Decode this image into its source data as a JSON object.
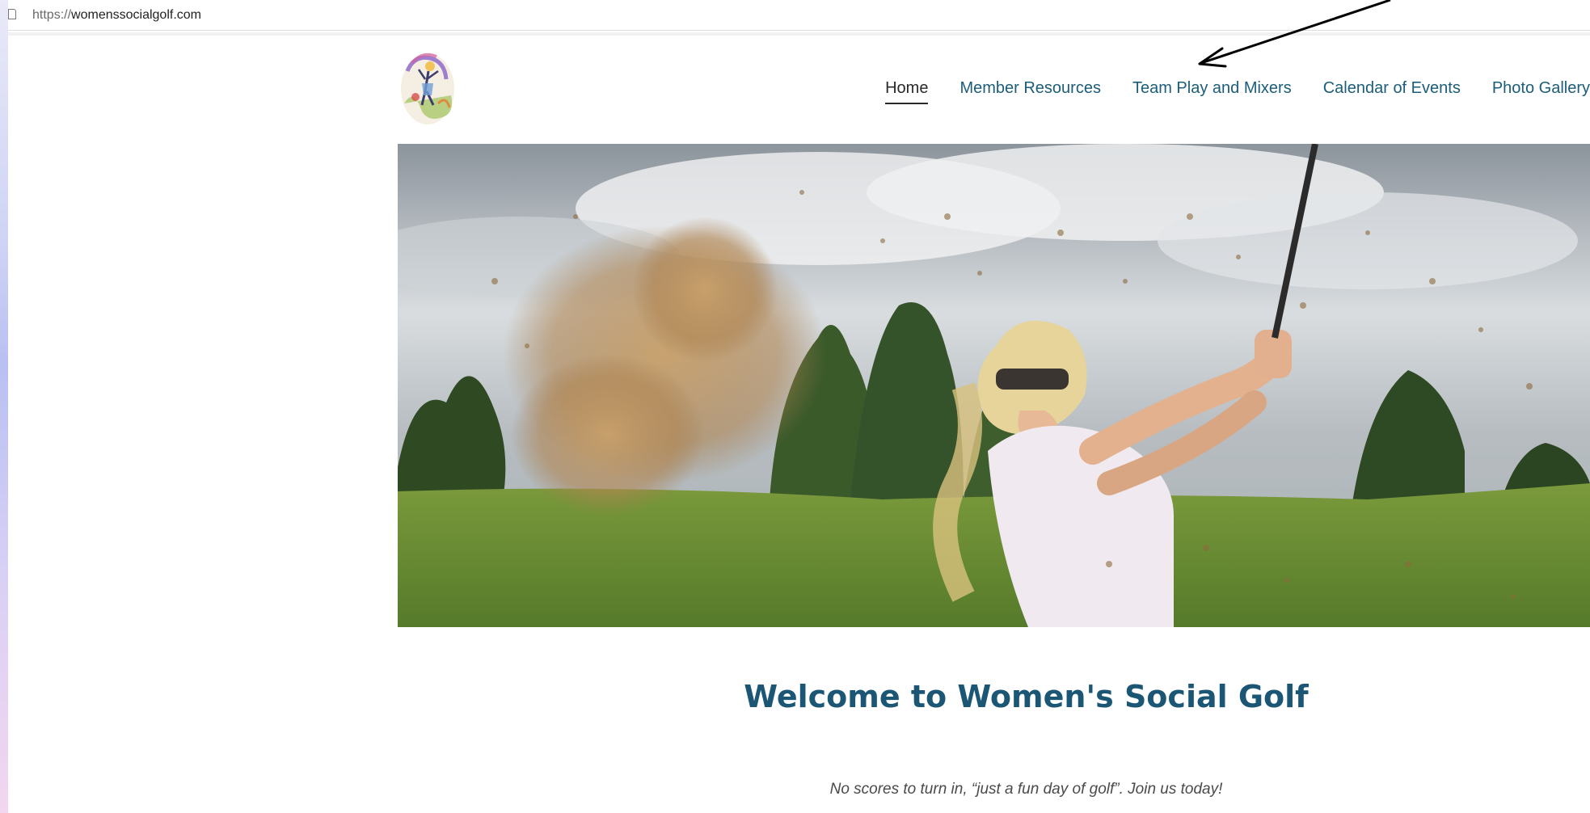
{
  "browser": {
    "url_scheme": "https://",
    "url_host": "womenssocialgolf.com"
  },
  "header": {
    "logo_icon": "golfer-woman-logo",
    "nav": [
      {
        "label": "Home",
        "active": true
      },
      {
        "label": "Member Resources",
        "active": false
      },
      {
        "label": "Team Play and Mixers",
        "active": false
      },
      {
        "label": "Calendar of Events",
        "active": false
      },
      {
        "label": "Photo Gallery",
        "active": false
      }
    ]
  },
  "hero": {
    "image": "woman-golfer-bunker-shot-photo"
  },
  "main": {
    "title": "Welcome to Women's Social Golf",
    "tagline": "No scores to turn in, “just a fun day of golf”.  Join us today!"
  },
  "colors": {
    "nav_link": "#1b5d7a",
    "title": "#1b5675",
    "active_underline": "#2a2a2a"
  }
}
